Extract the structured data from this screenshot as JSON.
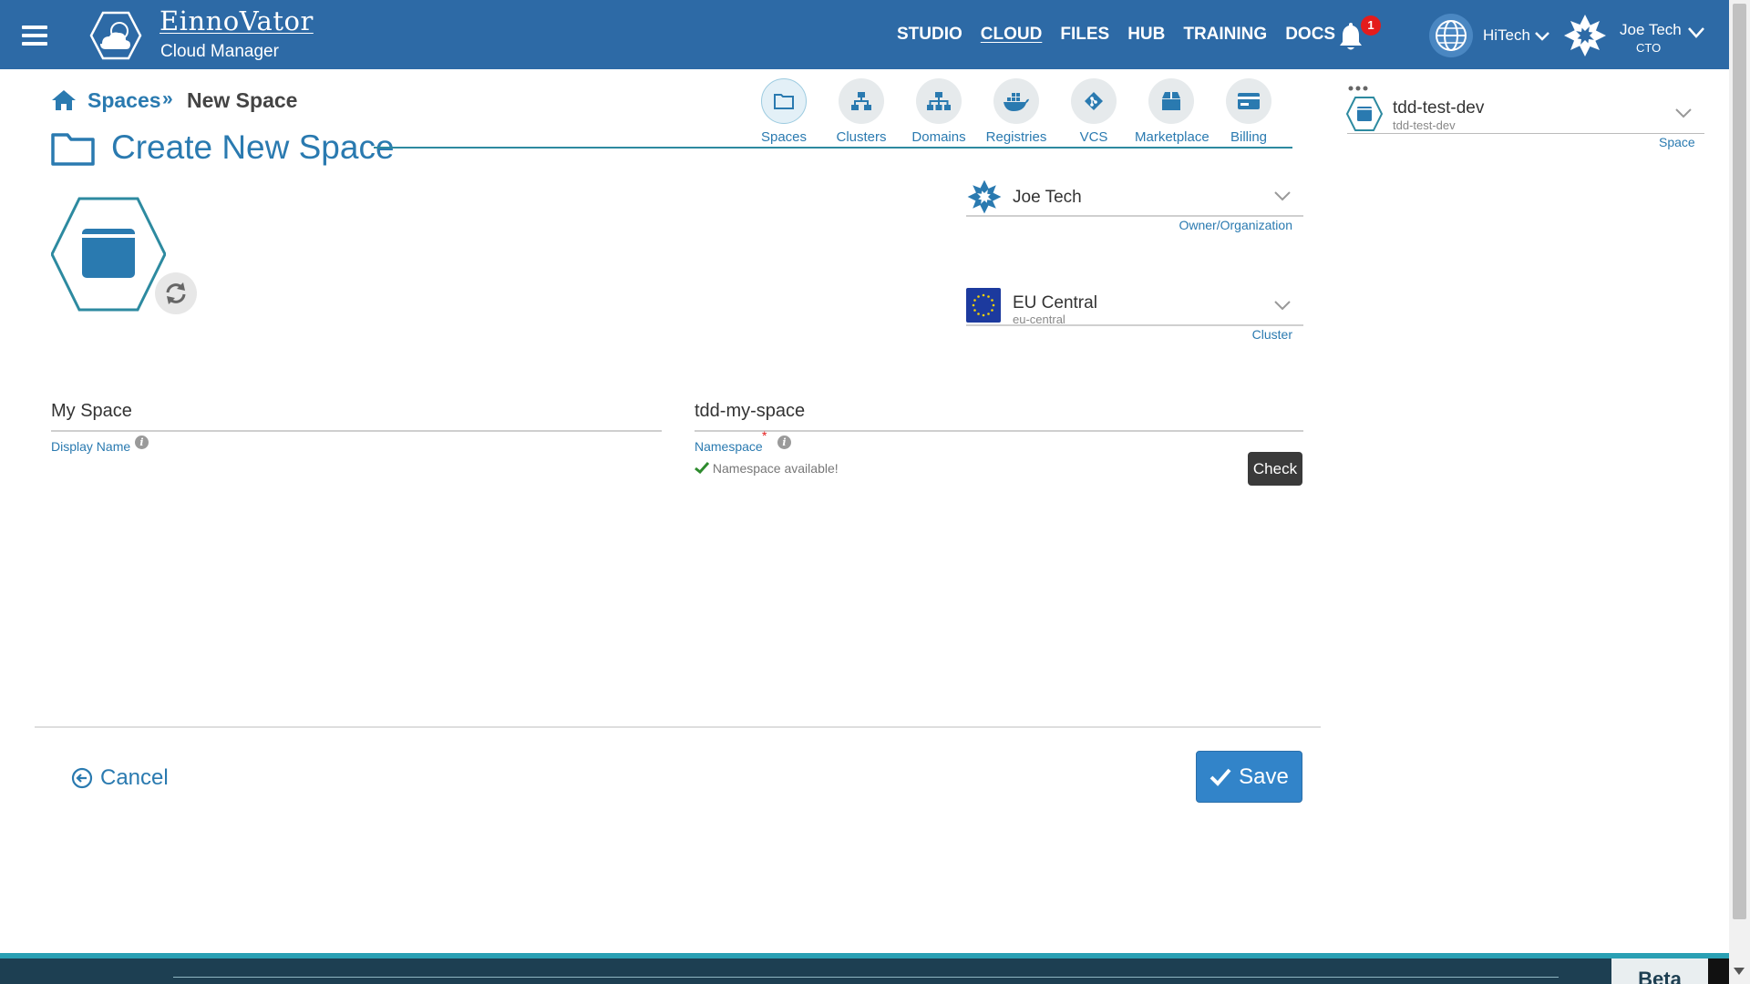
{
  "app": {
    "brand_name": "EinnoVator",
    "brand_sub": "Cloud Manager",
    "nav": [
      {
        "label": "STUDIO",
        "active": false
      },
      {
        "label": "CLOUD",
        "active": true
      },
      {
        "label": "FILES",
        "active": false
      },
      {
        "label": "HUB",
        "active": false
      },
      {
        "label": "TRAINING",
        "active": false
      },
      {
        "label": "DOCS",
        "active": false
      }
    ],
    "notification_count": "1",
    "tenant": "HiTech",
    "user_name": "Joe Tech",
    "user_role": "CTO"
  },
  "breadcrumb": {
    "parent": "Spaces",
    "separator": "»",
    "current": "New Space"
  },
  "page_title": "Create New Space",
  "icon_nav": [
    {
      "label": "Spaces",
      "icon": "folder-icon",
      "active": true
    },
    {
      "label": "Clusters",
      "icon": "sitemap-icon",
      "active": false
    },
    {
      "label": "Domains",
      "icon": "network-icon",
      "active": false
    },
    {
      "label": "Registries",
      "icon": "docker-icon",
      "active": false
    },
    {
      "label": "VCS",
      "icon": "git-icon",
      "active": false
    },
    {
      "label": "Marketplace",
      "icon": "box-icon",
      "active": false
    },
    {
      "label": "Billing",
      "icon": "credit-card-icon",
      "active": false
    }
  ],
  "space_selector": {
    "title": "tdd-test-dev",
    "subtitle": "tdd-test-dev",
    "label": "Space"
  },
  "owner": {
    "value": "Joe Tech",
    "label": "Owner/Organization"
  },
  "cluster": {
    "value": "EU Central",
    "sub": "eu-central",
    "label": "Cluster"
  },
  "form": {
    "display_name_value": "My Space",
    "display_name_label": "Display Name",
    "namespace_value": "tdd-my-space",
    "namespace_label": "Namespace",
    "namespace_required": "*",
    "namespace_status": "Namespace available!",
    "check_label": "Check"
  },
  "actions": {
    "cancel_label": "Cancel",
    "save_label": "Save"
  },
  "footer": {
    "beta_label": "Beta"
  },
  "colors": {
    "topbar": "#2d6aa6",
    "accent": "#2a7ab0",
    "save": "#3284c9",
    "hex_outline": "#2d8aa0",
    "success": "#2e8b2e",
    "badge": "#e41c1c"
  }
}
